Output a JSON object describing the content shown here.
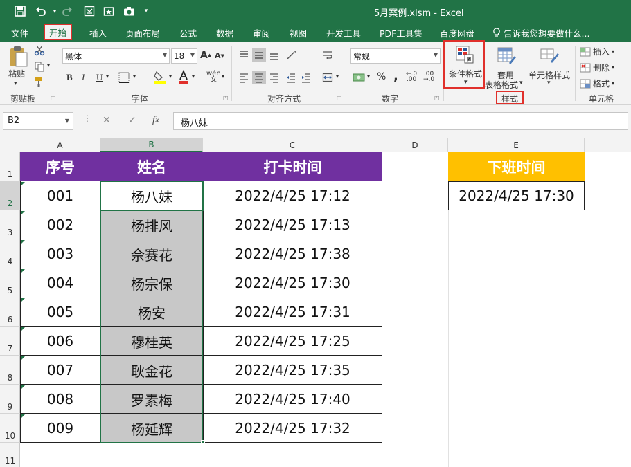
{
  "window": {
    "title": "5月案例.xlsm - Excel"
  },
  "quick_access": {
    "icons": [
      "save-icon",
      "undo-icon",
      "redo-icon",
      "camera-icon"
    ]
  },
  "menu": {
    "tabs": [
      "文件",
      "开始",
      "插入",
      "页面布局",
      "公式",
      "数据",
      "审阅",
      "视图",
      "开发工具",
      "PDF工具集",
      "百度网盘"
    ],
    "active_tab": "开始",
    "tell_me": "告诉我您想要做什么..."
  },
  "ribbon": {
    "clipboard": {
      "paste_label": "粘贴",
      "group_label": "剪贴板"
    },
    "font": {
      "font_name": "黑体",
      "font_size": "18",
      "bold": "B",
      "italic": "I",
      "underline": "U",
      "increase": "A",
      "decrease": "A",
      "phonetic": "wén",
      "group_label": "字体"
    },
    "alignment": {
      "group_label": "对齐方式"
    },
    "number": {
      "format": "常规",
      "percent": "%",
      "comma": ",",
      "group_label": "数字"
    },
    "styles": {
      "conditional_format": "条件格式",
      "table_format_1": "套用",
      "table_format_2": "表格格式",
      "cell_styles": "单元格样式",
      "group_label": "样式"
    },
    "cells": {
      "insert": "插入",
      "delete": "删除",
      "format": "格式",
      "group_label": "单元格"
    }
  },
  "formula_bar": {
    "name_box": "B2",
    "fx": "fx",
    "value": "杨八妹"
  },
  "columns": [
    "A",
    "B",
    "C",
    "D",
    "E"
  ],
  "rows": [
    "1",
    "2",
    "3",
    "4",
    "5",
    "6",
    "7",
    "8",
    "9",
    "10",
    "11"
  ],
  "table": {
    "headers": {
      "seq": "序号",
      "name": "姓名",
      "time": "打卡时间"
    },
    "records": [
      {
        "seq": "001",
        "name": "杨八妹",
        "time": "2022/4/25  17:12"
      },
      {
        "seq": "002",
        "name": "杨排风",
        "time": "2022/4/25  17:13"
      },
      {
        "seq": "003",
        "name": "佘赛花",
        "time": "2022/4/25  17:38"
      },
      {
        "seq": "004",
        "name": "杨宗保",
        "time": "2022/4/25  17:30"
      },
      {
        "seq": "005",
        "name": "杨安",
        "time": "2022/4/25  17:31"
      },
      {
        "seq": "006",
        "name": "穆桂英",
        "time": "2022/4/25  17:25"
      },
      {
        "seq": "007",
        "name": "耿金花",
        "time": "2022/4/25  17:35"
      },
      {
        "seq": "008",
        "name": "罗素梅",
        "time": "2022/4/25  17:40"
      },
      {
        "seq": "009",
        "name": "杨延辉",
        "time": "2022/4/25  17:32"
      }
    ]
  },
  "offwork": {
    "header": "下班时间",
    "value": "2022/4/25  17:30"
  },
  "colors": {
    "excel_green": "#217346",
    "header_purple": "#7030a0",
    "header_gold": "#ffc000",
    "selection_grey": "#c8c8c8",
    "highlight_red": "#e0302b"
  }
}
